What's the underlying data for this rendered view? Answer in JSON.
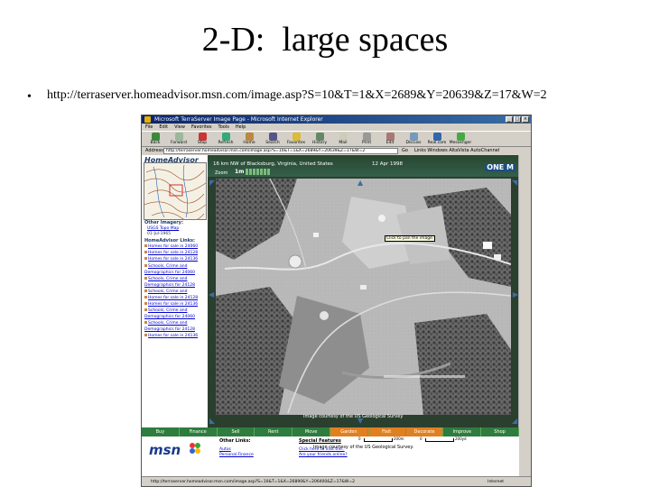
{
  "slide": {
    "title": "2-D:  large spaces",
    "bullet": "•",
    "url": "http://terraserver.homeadvisor.msn.com/image.asp?S=10&T=1&X=2689&Y=20639&Z=17&W=2"
  },
  "browser": {
    "window_title": "Microsoft TerraServer Image Page - Microsoft Internet Explorer",
    "menu": [
      "File",
      "Edit",
      "View",
      "Favorites",
      "Tools",
      "Help"
    ],
    "toolbar": [
      "Back",
      "Forward",
      "Stop",
      "Refresh",
      "Home",
      "Search",
      "Favorites",
      "History",
      "Mail",
      "Print",
      "Edit",
      "Discuss",
      "Real.com",
      "Messenger"
    ],
    "address_label": "Address",
    "address_value": "http://terraserver.homeadvisor.msn.com/image.asp?S=10&T=1&X=2689&Y=20639&Z=17&W=2",
    "go": "Go",
    "links": "Links  Windows  AltaVista AutoChannel",
    "status_text": "http://terraserver.homeadvisor.msn.com/image.asp?S=10&T=1&X=26890&Y=206400&Z=17&W=2",
    "status_zone": "Internet"
  },
  "page": {
    "logo": "HomeAdvisor",
    "other_imagery_head": "Other Imagery:",
    "other_imagery": [
      "USGS Topo Map",
      "01-Jul-1965"
    ],
    "links_head": "HomeAdvisor Links:",
    "links": [
      "Homes for sale in 24060",
      "Homes for sale in 24128",
      "Homes for sale in 24136",
      "Schools, Crime and",
      "Demographics for 24060",
      "Schools, Crime and",
      "Demographics for 24128",
      "Schools, Crime and",
      "Homes for sale in 24128",
      "Homes for sale in 24136",
      "Schools, Crime and",
      "Demographics for 24060",
      "Schools, Crime and",
      "Demographics for 24128",
      "Homes for sale in 24136"
    ],
    "map_title": "16 km NW of Blacksburg, Virginia, United States",
    "map_date": "12 Apr 1998",
    "one_million": "ONE M",
    "zoom_label": "Zoom",
    "zoom_value": "1m",
    "tooltip": "Click to pan the image.",
    "caption": "Image courtesy of the US Geological Survey",
    "tabs": [
      "Buy",
      "Finance",
      "Sell",
      "Rent",
      "Move",
      "Garden",
      "Fixit",
      "Decorate",
      "Improve",
      "Shop"
    ],
    "msn": "msn",
    "other_links_head": "Other Links:",
    "other_links": [
      "Autos",
      "Personal Finance"
    ],
    "special_features_head": "Special Features",
    "special_features": [
      "Click here to visit the..",
      "Are your friends online?"
    ],
    "footer_caption": "Image courtesy of the US Geological Survey.",
    "scale_labels": [
      "0",
      "200m",
      "0",
      "200yd"
    ]
  },
  "colors": {
    "green_nav": "#2e7d3e",
    "highlight_tab": "#e08020",
    "ie_title": "#0a246a"
  }
}
